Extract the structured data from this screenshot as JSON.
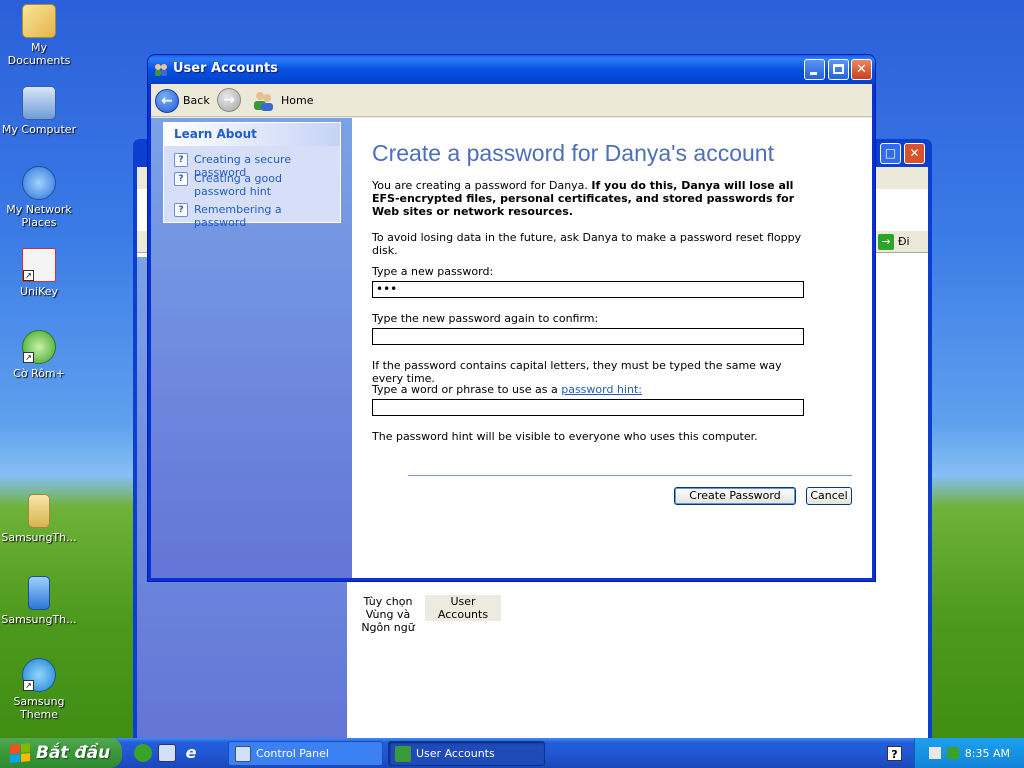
{
  "desktop": {
    "icons": [
      {
        "label": "My Documents",
        "icon": "folder-documents-icon"
      },
      {
        "label": "My Computer",
        "icon": "computer-icon"
      },
      {
        "label": "My Network Places",
        "icon": "network-icon"
      },
      {
        "label": "UniKey",
        "icon": "unikey-icon"
      },
      {
        "label": "Cờ Rôm+",
        "icon": "chess-icon"
      },
      {
        "label": "SamsungTh...",
        "icon": "samsung-icon"
      },
      {
        "label": "SamsungTh...",
        "icon": "samsung-icon"
      },
      {
        "label": "Samsung Theme",
        "icon": "samsung-theme-icon"
      }
    ]
  },
  "bg_window": {
    "go_label": "Đi",
    "items": [
      {
        "label": "Tùy chọn Vùng và Ngôn ngữ"
      },
      {
        "label": "User Accounts"
      }
    ]
  },
  "window": {
    "title": "User Accounts",
    "nav": {
      "back_label": "Back",
      "home_label": "Home"
    },
    "learn_about": {
      "heading": "Learn About",
      "items": [
        "Creating a secure password",
        "Creating a good password hint",
        "Remembering a password"
      ]
    },
    "content": {
      "heading": "Create a password for Danya's account",
      "intro_plain": "You are creating a password for Danya.",
      "intro_bold": "If you do this, Danya will lose all EFS-encrypted files, personal certificates, and stored passwords for Web sites or network resources.",
      "reset_note": "To avoid losing data in the future, ask Danya to make a password reset floppy disk.",
      "new_password_label": "Type a new password:",
      "new_password_value": "•••",
      "confirm_label": "Type the new password again to confirm:",
      "confirm_value": "",
      "capital_note": "If the password contains capital letters, they must be typed the same way every time.",
      "hint_label_prefix": "Type a word or phrase to use as a",
      "hint_link": "password hint:",
      "hint_value": "",
      "hint_note": "The password hint will be visible to everyone who uses this computer.",
      "create_button": "Create Password",
      "cancel_button": "Cancel"
    }
  },
  "taskbar": {
    "start_label": "Bắt đầu",
    "tasks": [
      {
        "label": "Control Panel",
        "active": false
      },
      {
        "label": "User Accounts",
        "active": true
      }
    ],
    "clock": "8:35 AM"
  }
}
